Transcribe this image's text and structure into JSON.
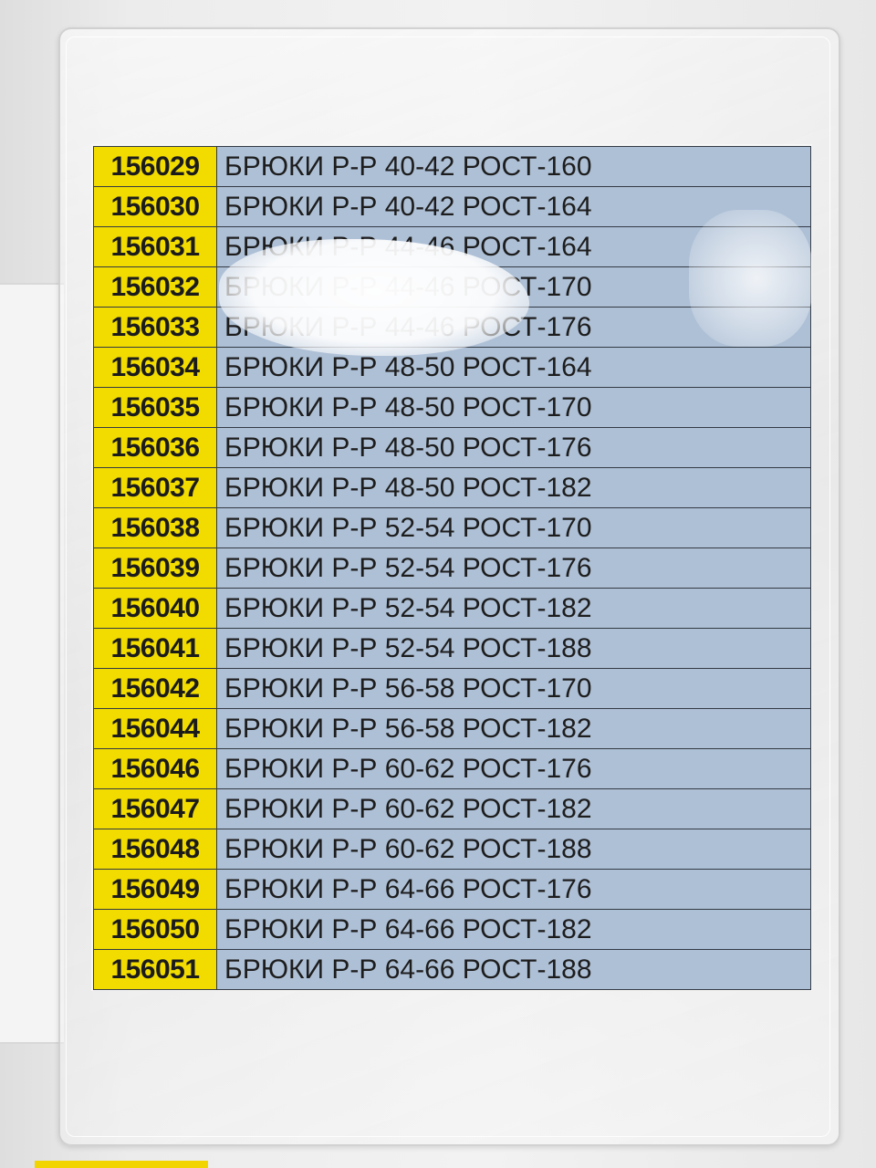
{
  "rows": [
    {
      "code": "156029",
      "desc": "БРЮКИ Р-Р 40-42 РОСТ-160"
    },
    {
      "code": "156030",
      "desc": "БРЮКИ Р-Р 40-42 РОСТ-164"
    },
    {
      "code": "156031",
      "desc": "БРЮКИ Р-Р 44-46 РОСТ-164"
    },
    {
      "code": "156032",
      "desc": "БРЮКИ Р-Р 44-46 РОСТ-170"
    },
    {
      "code": "156033",
      "desc": "БРЮКИ Р-Р 44-46 РОСТ-176"
    },
    {
      "code": "156034",
      "desc": "БРЮКИ Р-Р 48-50 РОСТ-164"
    },
    {
      "code": "156035",
      "desc": "БРЮКИ Р-Р 48-50 РОСТ-170"
    },
    {
      "code": "156036",
      "desc": "БРЮКИ Р-Р 48-50 РОСТ-176"
    },
    {
      "code": "156037",
      "desc": "БРЮКИ Р-Р 48-50 РОСТ-182"
    },
    {
      "code": "156038",
      "desc": "БРЮКИ Р-Р 52-54 РОСТ-170"
    },
    {
      "code": "156039",
      "desc": "БРЮКИ Р-Р 52-54 РОСТ-176"
    },
    {
      "code": "156040",
      "desc": "БРЮКИ Р-Р 52-54 РОСТ-182"
    },
    {
      "code": "156041",
      "desc": "БРЮКИ Р-Р 52-54 РОСТ-188"
    },
    {
      "code": "156042",
      "desc": "БРЮКИ Р-Р 56-58 РОСТ-170"
    },
    {
      "code": "156044",
      "desc": "БРЮКИ Р-Р 56-58 РОСТ-182"
    },
    {
      "code": "156046",
      "desc": "БРЮКИ Р-Р 60-62 РОСТ-176"
    },
    {
      "code": "156047",
      "desc": "БРЮКИ Р-Р 60-62 РОСТ-182"
    },
    {
      "code": "156048",
      "desc": "БРЮКИ Р-Р 60-62 РОСТ-188"
    },
    {
      "code": "156049",
      "desc": "БРЮКИ Р-Р 64-66 РОСТ-176"
    },
    {
      "code": "156050",
      "desc": "БРЮКИ Р-Р 64-66 РОСТ-182"
    },
    {
      "code": "156051",
      "desc": "БРЮКИ Р-Р 64-66 РОСТ-188"
    }
  ],
  "colors": {
    "code_background": "#f2dc00",
    "description_background": "#aec0d6",
    "grid_lines": "#333a44"
  }
}
